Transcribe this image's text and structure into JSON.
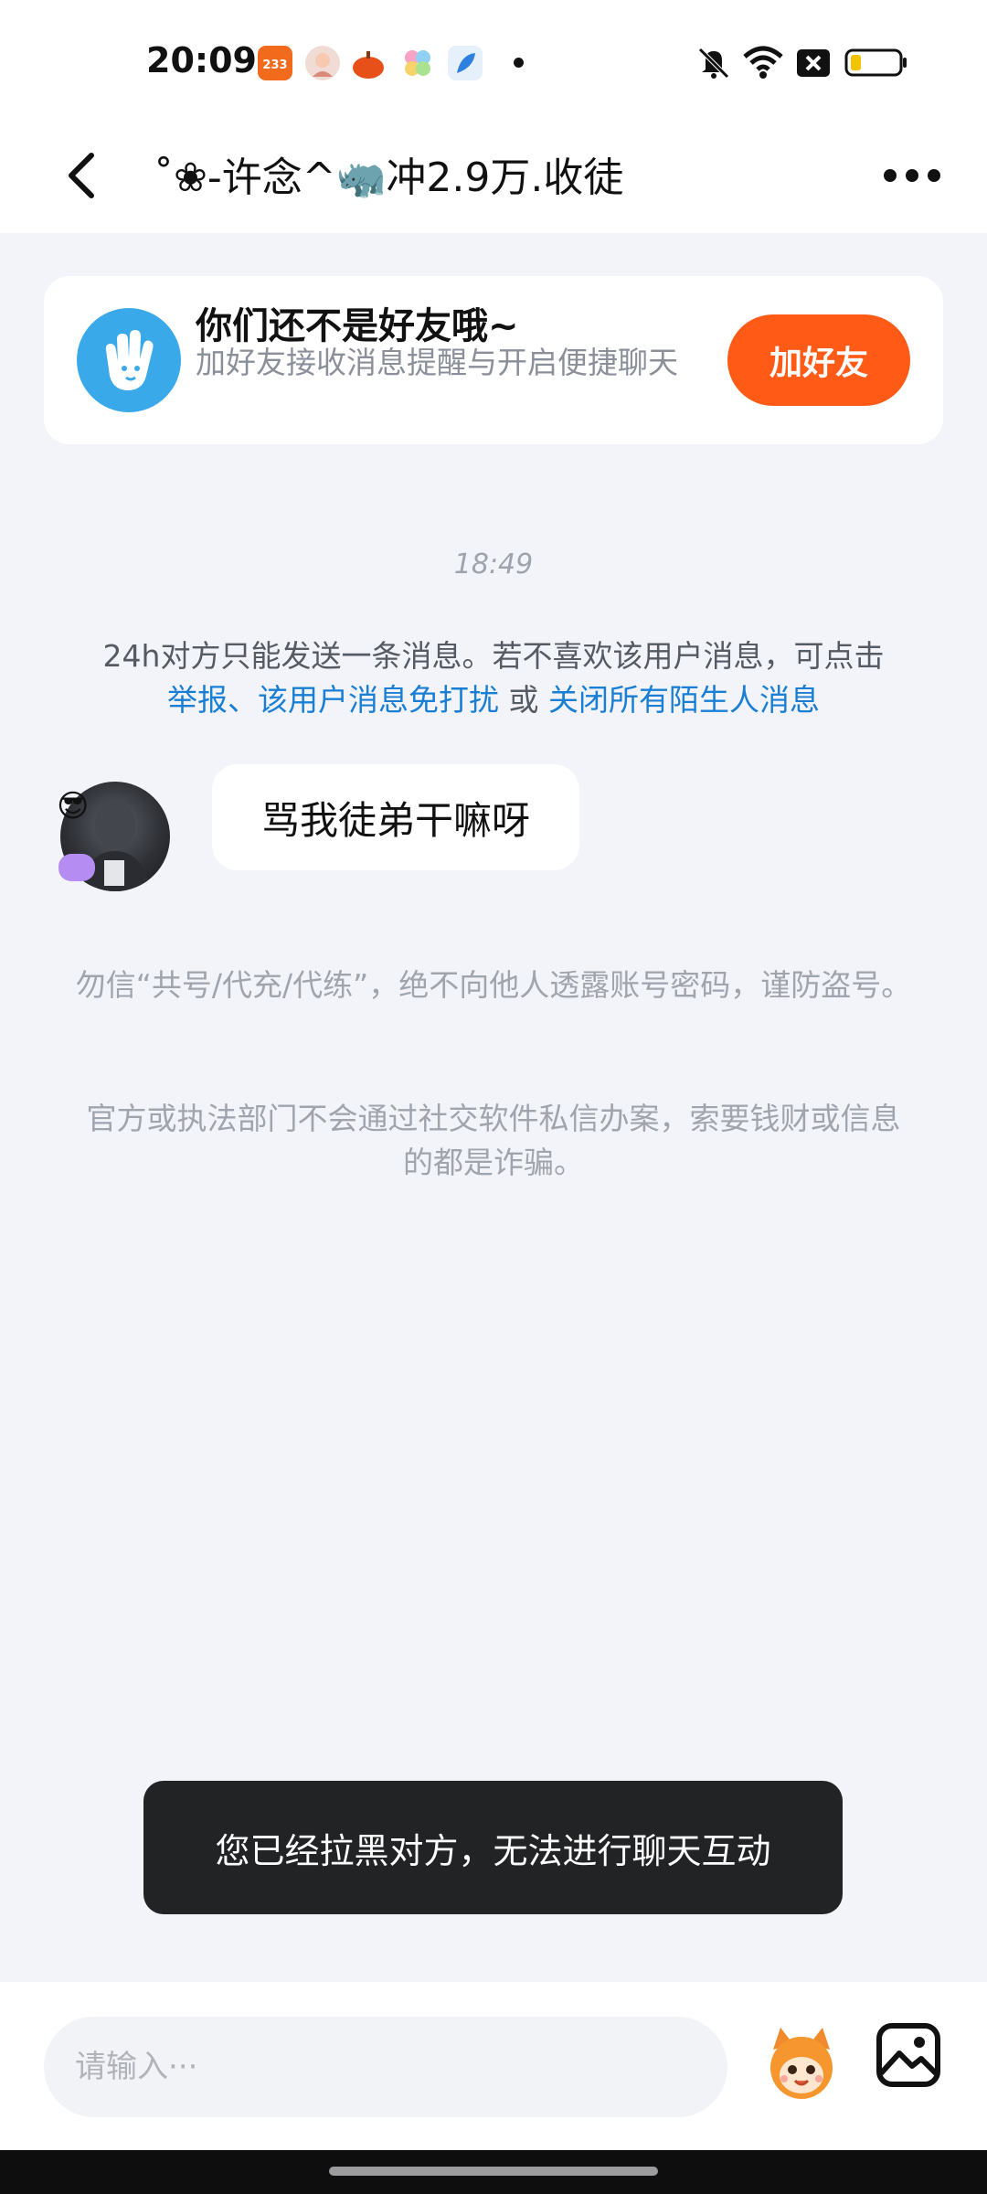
{
  "status_bar": {
    "time": "20:09",
    "app_icons": [
      "233-game-icon",
      "avatar-app-icon",
      "pumpkin-app-icon",
      "flower-app-icon",
      "feather-app-icon"
    ],
    "status_icons": [
      "mute-icon",
      "wifi-icon",
      "close-box-icon",
      "battery-icon"
    ]
  },
  "header": {
    "title": "˚❀-许念^🦏冲2.9万.收徒",
    "back_icon": "chevron-left-icon",
    "more_icon": "more-dots-icon"
  },
  "friend_banner": {
    "title": "你们还不是好友哦~",
    "subtitle": "加好友接收消息提醒与开启便捷聊天",
    "button_label": "加好友",
    "button_color": "#ff5a16"
  },
  "conversation": {
    "timestamp": "18:49",
    "notice_text": "24h对方只能发送一条消息。若不喜欢该用户消息，可点击",
    "notice_link_1": "举报、该用户消息免打扰",
    "notice_or": " 或 ",
    "notice_link_2": "关闭所有陌生人消息",
    "message": "骂我徒弟干嘛呀",
    "safety_1": "勿信“共号/代充/代练”，绝不向他人透露账号密码，谨防盗号。",
    "safety_2": "官方或执法部门不会通过社交软件私信办案，索要钱财或信息的都是诈骗。"
  },
  "toast": {
    "text": "您已经拉黑对方，无法进行聊天互动"
  },
  "input_bar": {
    "placeholder": "请输入···",
    "emoji_icon": "mascot-emoji-icon",
    "image_icon": "image-icon"
  },
  "colors": {
    "link": "#1a7fd4",
    "background": "#f3f4f9",
    "toast": "#222325"
  }
}
